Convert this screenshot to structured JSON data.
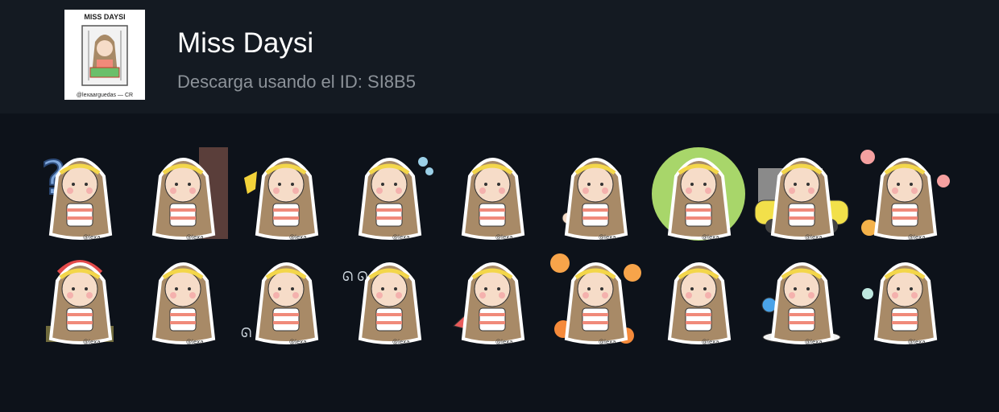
{
  "pack": {
    "title": "Miss Daysi",
    "subtitle": "Descarga usando el ID: SI8B5",
    "icon_caption_top": "MISS DAYSI",
    "icon_caption_bottom": "@lexaarguedas — CR"
  },
  "stickers": [
    {
      "watermark": "@lexa",
      "variant": "question"
    },
    {
      "watermark": "@lexa",
      "variant": "peek-door"
    },
    {
      "watermark": "@lexa",
      "variant": "cross-arms"
    },
    {
      "watermark": "@lexa",
      "variant": "cheek-puff"
    },
    {
      "watermark": "@lexa",
      "variant": "cooking"
    },
    {
      "watermark": "@lexa",
      "variant": "thumbs-up"
    },
    {
      "watermark": "@lexa",
      "variant": "gift"
    },
    {
      "watermark": "@lexa",
      "variant": "car"
    },
    {
      "watermark": "@lexa",
      "variant": "flowers"
    },
    {
      "watermark": "@lexa",
      "variant": "headphones"
    },
    {
      "watermark": "@lexa",
      "variant": "hair-flip"
    },
    {
      "watermark": "@lexa",
      "variant": "walking-away"
    },
    {
      "watermark": "@lexa",
      "variant": "shy"
    },
    {
      "watermark": "@lexa",
      "variant": "fan"
    },
    {
      "watermark": "@lexa",
      "variant": "ok-flowers"
    },
    {
      "watermark": "@lexa",
      "variant": "standing"
    },
    {
      "watermark": "@lexa",
      "variant": "makeup"
    },
    {
      "watermark": "@lexa",
      "variant": "sigh"
    }
  ],
  "colors": {
    "header_bg": "#141a22",
    "page_bg": "#0d121a",
    "hair": "#a88a67",
    "skin": "#f6dcc8",
    "stripe": "#f08a7a",
    "headband": "#f3d64a"
  }
}
